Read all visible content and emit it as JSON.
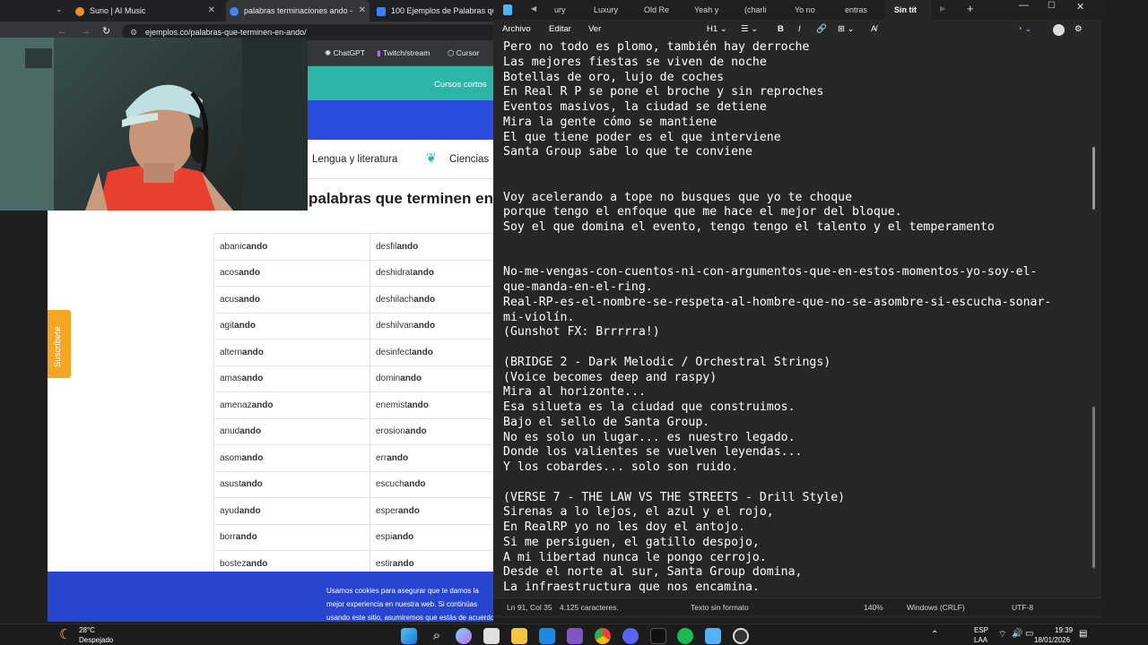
{
  "chrome": {
    "tabs": [
      {
        "label": "Suno | AI Music",
        "color": "#f28b30"
      },
      {
        "label": "palabras terminaciones ando -",
        "color": "#4285f4"
      },
      {
        "label": "100 Ejemplos de Palabras que",
        "color": "#3b82f6"
      }
    ],
    "url": "ejemplos.co/palabras-que-terminen-en-ando/",
    "bookmarks": [
      "ChatGPT",
      "Twitch/stream",
      "Cursor"
    ]
  },
  "page": {
    "top_link": "Cursos cortos",
    "categories": [
      "Lengua y literatura",
      "Ciencias"
    ],
    "heading": "palabras que terminen en",
    "subscribe": "Suscríbete",
    "rows": [
      [
        [
          "abanic",
          "ando"
        ],
        [
          "desfil",
          "ando"
        ]
      ],
      [
        [
          "acos",
          "ando"
        ],
        [
          "deshidrat",
          "ando"
        ]
      ],
      [
        [
          "acus",
          "ando"
        ],
        [
          "deshilach",
          "ando"
        ]
      ],
      [
        [
          "agit",
          "ando"
        ],
        [
          "deshilvan",
          "ando"
        ]
      ],
      [
        [
          "altern",
          "ando"
        ],
        [
          "desinfect",
          "ando"
        ]
      ],
      [
        [
          "amas",
          "ando"
        ],
        [
          "domin",
          "ando"
        ]
      ],
      [
        [
          "amenaz",
          "ando"
        ],
        [
          "enemist",
          "ando"
        ]
      ],
      [
        [
          "anud",
          "ando"
        ],
        [
          "erosion",
          "ando"
        ]
      ],
      [
        [
          "asom",
          "ando"
        ],
        [
          "err",
          "ando"
        ]
      ],
      [
        [
          "asust",
          "ando"
        ],
        [
          "escuch",
          "ando"
        ]
      ],
      [
        [
          "ayud",
          "ando"
        ],
        [
          "esper",
          "ando"
        ]
      ],
      [
        [
          "borr",
          "ando"
        ],
        [
          "espi",
          "ando"
        ]
      ],
      [
        [
          "bostez",
          "ando"
        ],
        [
          "estir",
          "ando"
        ]
      ]
    ],
    "cookie_text": "Usamos cookies para asegurar que te damos la mejor experiencia en nuestra web. Si continúas usando este sitio, asumiremos que estás de acuerdo con ello."
  },
  "notepad": {
    "tabs": [
      "ury",
      "Luxury",
      "Old Re",
      "Yeah y",
      "(charli",
      "Yo no",
      "entras",
      "Sin tít"
    ],
    "menus": [
      "Archivo",
      "Editar",
      "Ver"
    ],
    "heading_select": "H1",
    "lines": [
      "Pero no todo es plomo, también hay derroche",
      "Las mejores fiestas se viven de noche",
      "Botellas de oro, lujo de coches",
      "En Real R P se pone el broche y sin reproches",
      "Eventos masivos, la ciudad se detiene",
      "Mira la gente cómo se mantiene",
      "El que tiene poder es el que interviene",
      "Santa Group sabe lo que te conviene",
      "",
      "",
      "Voy acelerando a tope no busques que yo te choque",
      "porque tengo el enfoque que me hace el mejor del bloque.",
      "Soy el que domina el evento, tengo tengo el talento y el temperamento",
      "",
      "",
      "No-me-vengas-con-cuentos-ni-con-argumentos-que-en-estos-momentos-yo-soy-el-",
      "que-manda-en-el-ring.",
      "Real-RP-es-el-nombre-se-respeta-al-hombre-que-no-se-asombre-si-escucha-sonar-",
      "mi-violín.",
      "(Gunshot FX: Brrrrra!)",
      "",
      "(BRIDGE 2 - Dark Melodic / Orchestral Strings)",
      "(Voice becomes deep and raspy)",
      "Mira al horizonte...",
      "Esa silueta es la ciudad que construimos.",
      "Bajo el sello de Santa Group.",
      "No es solo un lugar... es nuestro legado.",
      "Donde los valientes se vuelven leyendas...",
      "Y los cobardes... solo son ruido.",
      "",
      "(VERSE 7 - THE LAW VS THE STREETS - Drill Style)",
      "Sirenas a lo lejos, el azul y el rojo,",
      "En RealRP yo no les doy el antojo.",
      "Si me persiguen, el gatillo despojo,",
      "A mi libertad nunca le pongo cerrojo.",
      "Desde el norte al sur, Santa Group domina,",
      "La infraestructura que nos encamina."
    ],
    "status": {
      "position": "Ln 91, Col 35",
      "chars": "4.125 caracteres.",
      "format": "Texto sin formato",
      "zoom": "140%",
      "eol": "Windows (CRLF)",
      "encoding": "UTF-8"
    }
  },
  "taskbar": {
    "weather_temp": "28°C",
    "weather_desc": "Despejado",
    "lang": "ESP",
    "lang2": "LAA",
    "time": "19:39",
    "date": "18/01/2026"
  }
}
